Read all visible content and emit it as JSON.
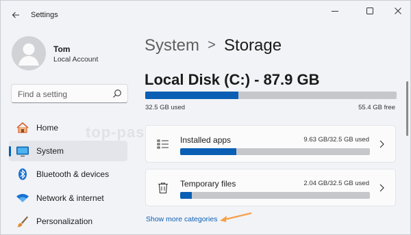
{
  "window": {
    "title": "Settings",
    "controls": {
      "minimize": "minimize-icon",
      "maximize": "maximize-icon",
      "close": "close-icon"
    }
  },
  "profile": {
    "name": "Tom",
    "account_type": "Local Account"
  },
  "search": {
    "placeholder": "Find a setting"
  },
  "sidebar": {
    "items": [
      {
        "label": "Home",
        "icon": "home-icon",
        "selected": false
      },
      {
        "label": "System",
        "icon": "system-display-icon",
        "selected": true
      },
      {
        "label": "Bluetooth & devices",
        "icon": "bluetooth-icon",
        "selected": false
      },
      {
        "label": "Network & internet",
        "icon": "wifi-icon",
        "selected": false
      },
      {
        "label": "Personalization",
        "icon": "brush-icon",
        "selected": false
      }
    ]
  },
  "breadcrumb": {
    "parent": "System",
    "separator": ">",
    "current": "Storage"
  },
  "disk": {
    "title": "Local Disk (C:) - 87.9 GB",
    "used_label": "32.5 GB used",
    "free_label": "55.4 GB free",
    "used_fraction": 0.37
  },
  "categories": [
    {
      "title": "Installed apps",
      "value": "9.63 GB/32.5 GB used",
      "icon": "list-icon",
      "fraction": 0.296
    },
    {
      "title": "Temporary files",
      "value": "2.04 GB/32.5 GB used",
      "icon": "trash-icon",
      "fraction": 0.063
    }
  ],
  "more_link": "Show more categories",
  "watermark": "top-password.com",
  "colors": {
    "accent": "#0a5fb4",
    "bar_track": "#c6c7cb",
    "background": "#f2f3f7",
    "annotation_arrow": "#f5a04a"
  }
}
